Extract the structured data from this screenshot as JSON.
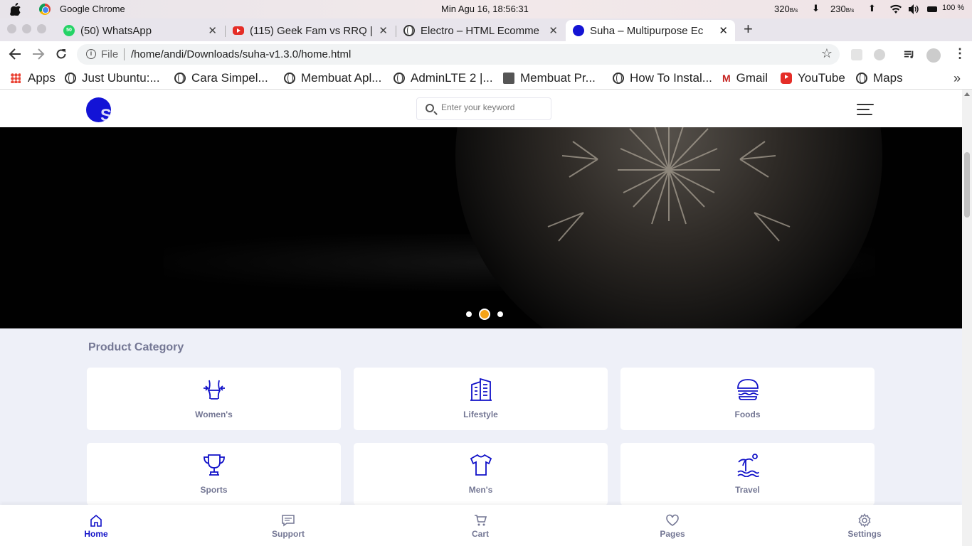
{
  "macbar": {
    "app_name": "Google Chrome",
    "clock": "Min Agu 16, 18:56:31",
    "net_down": "320",
    "net_down_unit": "B/s",
    "net_up": "230",
    "net_up_unit": "B/s",
    "down_arrow": "⬇",
    "up_arrow": "⬆",
    "battery": "100 %"
  },
  "tabs": [
    {
      "title": "(50) WhatsApp",
      "icon": "whatsapp-icon",
      "badge": "50"
    },
    {
      "title": "(115) Geek Fam vs RRQ | ",
      "icon": "youtube-icon"
    },
    {
      "title": "Electro – HTML Ecomme",
      "icon": "globe-icon"
    },
    {
      "title": "Suha – Multipurpose Ec",
      "icon": "suha-icon",
      "active": true
    }
  ],
  "toolbar": {
    "scheme": "File",
    "url": "/home/andi/Downloads/suha-v1.3.0/home.html"
  },
  "bookmarks": {
    "apps": "Apps",
    "items": [
      "Just Ubuntu:...",
      "Cara Simpel...",
      "Membuat Apl...",
      "AdminLTE 2 |...",
      "Membuat Pr...",
      "How To Instal...",
      "Gmail",
      "YouTube",
      "Maps"
    ],
    "more": "»"
  },
  "header": {
    "logo_letter": "S",
    "search_placeholder": "Enter your keyword"
  },
  "hero": {
    "slide_count": 3,
    "active_slide": 2
  },
  "category": {
    "title": "Product Category",
    "items": [
      {
        "label": "Women's",
        "icon": "women-icon"
      },
      {
        "label": "Lifestyle",
        "icon": "building-icon"
      },
      {
        "label": "Foods",
        "icon": "burger-icon"
      },
      {
        "label": "Sports",
        "icon": "trophy-icon"
      },
      {
        "label": "Men's",
        "icon": "tshirt-icon"
      },
      {
        "label": "Travel",
        "icon": "beach-icon"
      }
    ]
  },
  "footer_nav": [
    {
      "label": "Home",
      "icon": "home-icon",
      "active": true
    },
    {
      "label": "Support",
      "icon": "chat-icon"
    },
    {
      "label": "Cart",
      "icon": "cart-icon"
    },
    {
      "label": "Pages",
      "icon": "heart-icon"
    },
    {
      "label": "Settings",
      "icon": "gear-icon"
    }
  ],
  "colors": {
    "brand": "#1010c8",
    "accent": "#f6a316",
    "muted_text": "#747794",
    "page_bg": "#eef0f8"
  }
}
